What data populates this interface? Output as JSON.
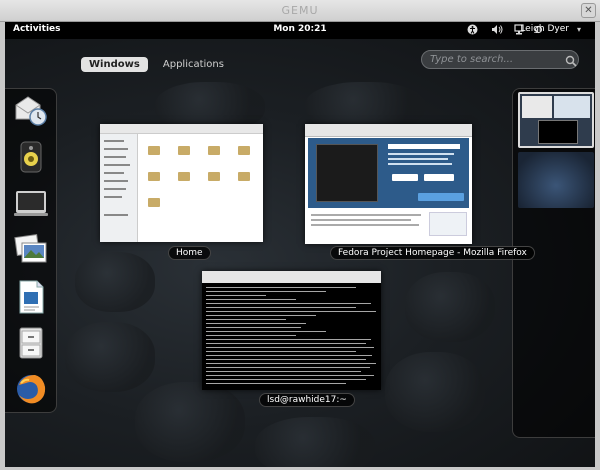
{
  "vm_window": {
    "title": "GEMU"
  },
  "top_bar": {
    "activities_label": "Activities",
    "clock": "Mon 20:21",
    "user_name": "Leigh Dyer"
  },
  "overview": {
    "tabs": [
      {
        "label": "Windows",
        "active": true
      },
      {
        "label": "Applications",
        "active": false
      }
    ],
    "search": {
      "placeholder": "Type to search...",
      "value": ""
    }
  },
  "windows": [
    {
      "caption": "Home"
    },
    {
      "caption": "Fedora Project Homepage - Mozilla Firefox"
    },
    {
      "caption": "lsd@rawhide17:~"
    }
  ],
  "dash": {
    "items": [
      "mail-clock-icon",
      "speaker-icon",
      "terminal-icon",
      "image-viewer-icon",
      "writer-icon",
      "file-cabinet-icon",
      "firefox-icon"
    ]
  },
  "colors": {
    "background": "#1b1f23",
    "top_bar": "#000000",
    "active_tab": "#e2e2e2",
    "fedora_blue": "#2d5b8a"
  }
}
